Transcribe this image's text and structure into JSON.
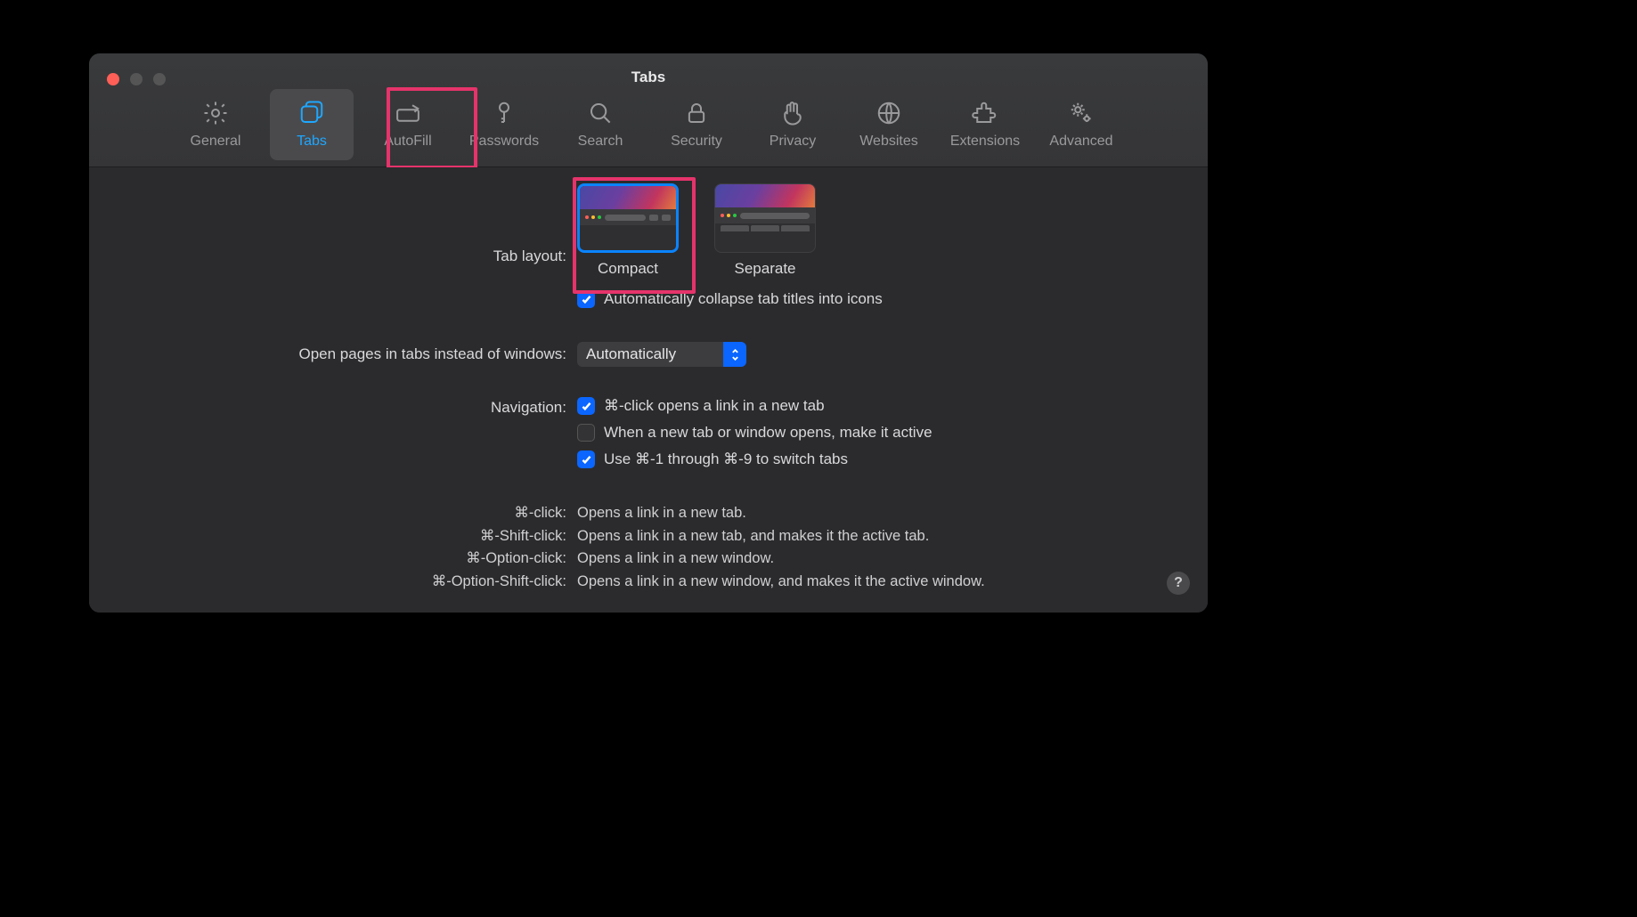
{
  "window": {
    "title": "Tabs"
  },
  "toolbar": {
    "tabs": [
      {
        "id": "general",
        "label": "General",
        "icon": "gear-icon"
      },
      {
        "id": "tabs",
        "label": "Tabs",
        "icon": "tabs-icon",
        "active": true
      },
      {
        "id": "autofill",
        "label": "AutoFill",
        "icon": "pencil-box-icon"
      },
      {
        "id": "passwords",
        "label": "Passwords",
        "icon": "key-icon"
      },
      {
        "id": "search",
        "label": "Search",
        "icon": "search-icon"
      },
      {
        "id": "security",
        "label": "Security",
        "icon": "lock-icon"
      },
      {
        "id": "privacy",
        "label": "Privacy",
        "icon": "hand-icon"
      },
      {
        "id": "websites",
        "label": "Websites",
        "icon": "globe-icon"
      },
      {
        "id": "extensions",
        "label": "Extensions",
        "icon": "puzzle-icon"
      },
      {
        "id": "advanced",
        "label": "Advanced",
        "icon": "gears-icon"
      }
    ]
  },
  "labels": {
    "tab_layout": "Tab layout:",
    "open_pages": "Open pages in tabs instead of windows:",
    "navigation": "Navigation:"
  },
  "tab_layout": {
    "options": {
      "compact": {
        "label": "Compact",
        "selected": true
      },
      "separate": {
        "label": "Separate",
        "selected": false
      }
    },
    "auto_collapse": {
      "label": "Automatically collapse tab titles into icons",
      "checked": true
    }
  },
  "open_pages": {
    "value": "Automatically"
  },
  "navigation": {
    "cmd_click": {
      "label": "⌘-click opens a link in a new tab",
      "checked": true
    },
    "make_active": {
      "label": "When a new tab or window opens, make it active",
      "checked": false
    },
    "cmd_num_switch": {
      "label": "Use ⌘-1 through ⌘-9 to switch tabs",
      "checked": true
    }
  },
  "help": {
    "rows": [
      {
        "k": "⌘-click:",
        "v": "Opens a link in a new tab."
      },
      {
        "k": "⌘-Shift-click:",
        "v": "Opens a link in a new tab, and makes it the active tab."
      },
      {
        "k": "⌘-Option-click:",
        "v": "Opens a link in a new window."
      },
      {
        "k": "⌘-Option-Shift-click:",
        "v": "Opens a link in a new window, and makes it the active window."
      }
    ]
  },
  "help_button": "?"
}
